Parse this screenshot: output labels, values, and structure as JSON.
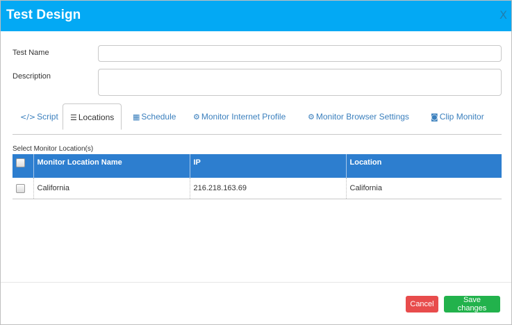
{
  "modal": {
    "title": "Test Design",
    "close_label": "X"
  },
  "form": {
    "test_name_label": "Test Name",
    "test_name_value": "",
    "description_label": "Description",
    "description_value": ""
  },
  "tabs": [
    {
      "label": "Script",
      "icon": "code-icon",
      "active": false
    },
    {
      "label": "Locations",
      "icon": "sliders-icon",
      "active": true
    },
    {
      "label": "Schedule",
      "icon": "calendar-icon",
      "active": false
    },
    {
      "label": "Monitor Internet Profile",
      "icon": "gear-icon",
      "active": false
    },
    {
      "label": "Monitor Browser Settings",
      "icon": "gears-icon",
      "active": false
    },
    {
      "label": "Clip Monitor",
      "icon": "camera-icon",
      "active": false
    }
  ],
  "locations": {
    "section_label": "Select Monitor Location(s)",
    "columns": [
      "Monitor Location Name",
      "IP",
      "Location"
    ],
    "rows": [
      {
        "name": "California",
        "ip": "216.218.163.69",
        "location": "California",
        "checked": false
      }
    ]
  },
  "footer": {
    "cancel_label": "Cancel",
    "save_label": "Save changes"
  },
  "colors": {
    "header": "#03a9f4",
    "table_header": "#2d7ecf",
    "cancel": "#e84c4c",
    "save": "#22b24c",
    "tab_link": "#3a7fbd"
  }
}
